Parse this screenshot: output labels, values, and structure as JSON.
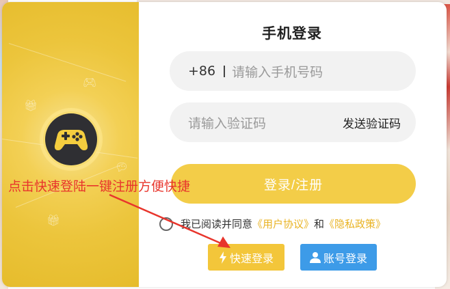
{
  "login": {
    "title": "手机登录",
    "phone_prefix": "+86",
    "phone_placeholder": "请输入手机号码",
    "code_placeholder": "请输入验证码",
    "send_code_label": "发送验证码",
    "submit_label": "登录/注册",
    "agree_text": "我已阅读并同意",
    "user_agreement": "《用户协议》",
    "and_text": "和",
    "privacy_policy": "《隐私政策》",
    "quick_login_label": "快速登录",
    "account_login_label": "账号登录"
  },
  "annotation": {
    "text": "点击快速登陆一键注册方便快捷"
  },
  "colors": {
    "brand_yellow": "#f3cd48",
    "account_blue": "#3d9be8",
    "link_yellow": "#e9b323",
    "annotation_red": "#e8352c"
  },
  "icons": {
    "logo": "gamepad-icon",
    "quick": "lightning-icon",
    "account": "user-icon",
    "checkbox": "radio-circle-icon"
  }
}
